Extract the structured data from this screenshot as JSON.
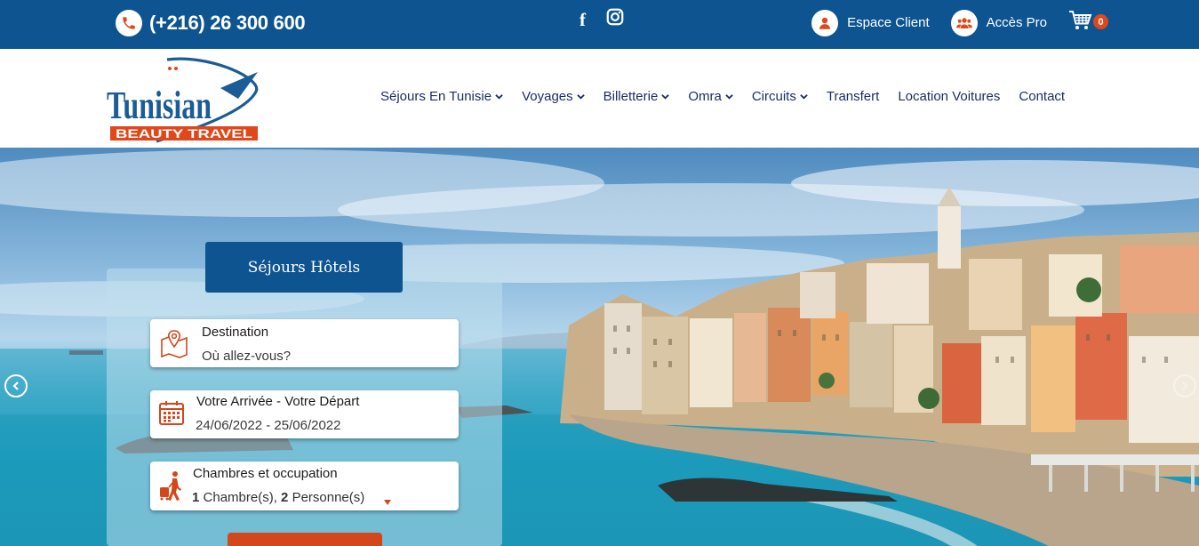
{
  "topbar": {
    "phone": "(+216) 26 300 600",
    "social": [
      "facebook-icon",
      "instagram-icon"
    ],
    "links": [
      {
        "label": "Espace Client",
        "icon": "user-icon"
      },
      {
        "label": "Accès Pro",
        "icon": "users-icon"
      }
    ],
    "cart_count": "0"
  },
  "brand": {
    "logo_line1": "Tunisian",
    "logo_line2": "BEAUTY TRAVEL"
  },
  "nav": [
    {
      "label": "Séjours En Tunisie",
      "dropdown": true
    },
    {
      "label": "Voyages",
      "dropdown": true
    },
    {
      "label": "Billetterie",
      "dropdown": true
    },
    {
      "label": "Omra",
      "dropdown": true
    },
    {
      "label": "Circuits",
      "dropdown": true
    },
    {
      "label": "Transfert",
      "dropdown": false
    },
    {
      "label": "Location Voitures",
      "dropdown": false
    },
    {
      "label": "Contact",
      "dropdown": false
    }
  ],
  "search": {
    "tab_label": "Séjours Hôtels",
    "destination": {
      "label": "Destination",
      "placeholder": "Où allez-vous?"
    },
    "dates": {
      "label": "Votre Arrivée - Votre Départ",
      "value": "24/06/2022 - 25/06/2022"
    },
    "rooms": {
      "label": "Chambres et occupation",
      "rooms_count": "1",
      "rooms_text": "Chambre(s),",
      "persons_count": "2",
      "persons_text": "Personne(s)"
    }
  },
  "colors": {
    "primary": "#0d5491",
    "accent": "#d3471b",
    "nav_text": "#1d2d63"
  }
}
